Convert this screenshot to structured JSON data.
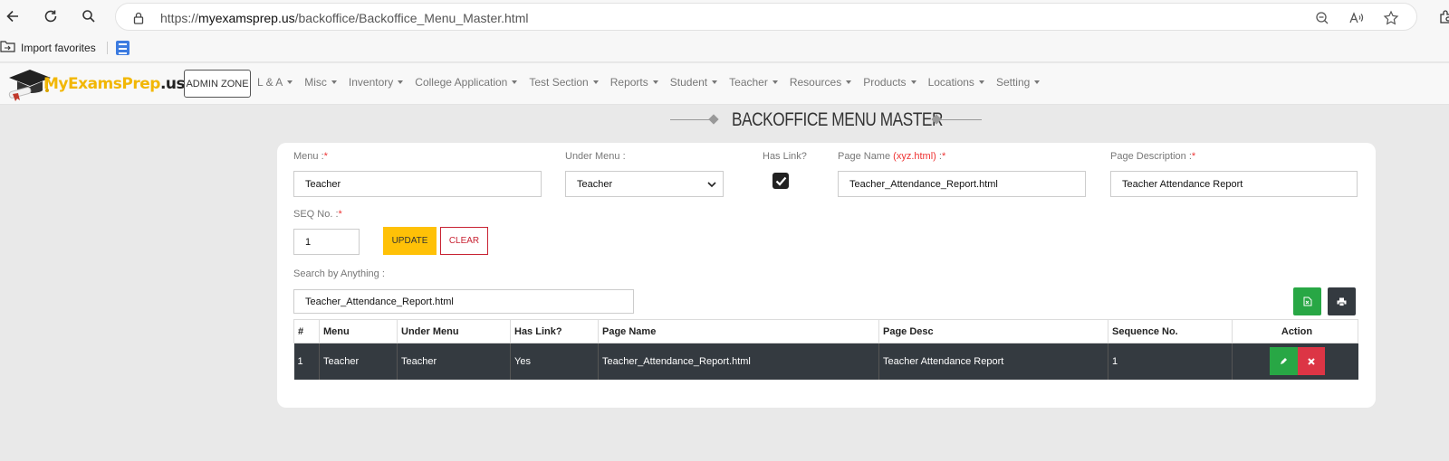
{
  "browser": {
    "url_prefix": "https://",
    "url_domain": "myexamsprep.us",
    "url_path": "/backoffice/Backoffice_Menu_Master.html",
    "favorites_label": "Import favorites"
  },
  "site": {
    "logo_main": "MyExamsPrep",
    "logo_suffix": ".us",
    "admin_zone": "ADMIN ZONE",
    "menu": [
      "L & A",
      "Misc",
      "Inventory",
      "College Application",
      "Test Section",
      "Reports",
      "Student",
      "Teacher",
      "Resources",
      "Products",
      "Locations",
      "Setting"
    ]
  },
  "page": {
    "title": "BACKOFFICE MENU MASTER"
  },
  "form": {
    "menu_label": "Menu :",
    "menu_value": "Teacher",
    "under_menu_label": "Under Menu :",
    "under_menu_value": "Teacher",
    "has_link_label": "Has Link?",
    "has_link_checked": true,
    "page_name_label": "Page Name",
    "page_name_hint": "(xyz.html)",
    "page_name_value": "Teacher_Attendance_Report.html",
    "page_desc_label": "Page Description :",
    "page_desc_value": "Teacher Attendance Report",
    "seq_label": "SEQ No. :",
    "seq_value": "1",
    "required_mark": "*",
    "update_label": "UPDATE",
    "clear_label": "CLEAR",
    "search_label": "Search by Anything :",
    "search_value": "Teacher_Attendance_Report.html"
  },
  "table": {
    "headers": [
      "#",
      "Menu",
      "Under Menu",
      "Has Link?",
      "Page Name",
      "Page Desc",
      "Sequence No.",
      "Action"
    ],
    "rows": [
      [
        "1",
        "Teacher",
        "Teacher",
        "Yes",
        "Teacher_Attendance_Report.html",
        "Teacher Attendance Report",
        "1"
      ]
    ]
  },
  "colors": {
    "update": "#ffc107",
    "clear": "#c82333",
    "export": "#28a745",
    "print": "#343a40",
    "row_bg": "#343a40",
    "edit": "#28a745",
    "delete": "#dc3545",
    "logo": "#f2b705"
  },
  "icons": [
    "back-arrow-icon",
    "refresh-icon",
    "search-icon",
    "lock-icon",
    "zoom-out-icon",
    "read-aloud-icon",
    "star-icon",
    "extensions-icon",
    "import-folder-icon",
    "doc-icon",
    "excel-icon",
    "print-icon",
    "pencil-icon",
    "close-icon"
  ]
}
